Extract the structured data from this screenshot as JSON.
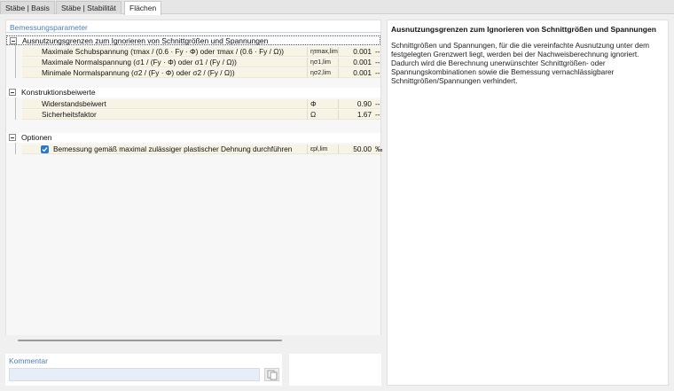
{
  "tabs": [
    {
      "label": "Stäbe | Basis"
    },
    {
      "label": "Stäbe | Stabilität"
    },
    {
      "label": "Flächen"
    }
  ],
  "params_panel": {
    "title": "Bemessungsparameter",
    "groups": [
      {
        "label": "Ausnutzungsgrenzen zum Ignorieren von Schnittgrößen und Spannungen",
        "rows": [
          {
            "label": "Maximale Schubspannung (τmax / (0.6 · Fy · Φ) oder τmax / (0.6 · Fy / Ω))",
            "symbol": "ητmax,lim",
            "value": "0.001",
            "unit": "--"
          },
          {
            "label": "Maximale Normalspannung (σ1 / (Fy · Φ) oder σ1 / (Fy / Ω))",
            "symbol": "ησ1,lim",
            "value": "0.001",
            "unit": "--"
          },
          {
            "label": "Minimale Normalspannung (σ2 / (Fy · Φ) oder σ2 / (Fy / Ω))",
            "symbol": "ησ2,lim",
            "value": "0.001",
            "unit": "--"
          }
        ]
      },
      {
        "label": "Konstruktionsbeiwerte",
        "rows": [
          {
            "label": "Widerstandsbeiwert",
            "symbol": "Φ",
            "value": "0.90",
            "unit": "--"
          },
          {
            "label": "Sicherheitsfaktor",
            "symbol": "Ω",
            "value": "1.67",
            "unit": "--"
          }
        ]
      },
      {
        "label": "Optionen",
        "rows": [
          {
            "label": "Bemessung gemäß maximal zulässiger plastischer Dehnung durchführen",
            "symbol": "εpl,lim",
            "value": "50.00",
            "unit": "‰",
            "checked": true
          }
        ]
      }
    ]
  },
  "comment": {
    "label": "Kommentar",
    "value": ""
  },
  "info": {
    "title": "Ausnutzungsgrenzen zum Ignorieren von Schnittgrößen und Spannungen",
    "text": "Schnittgrößen und Spannungen, für die die vereinfachte Ausnutzung unter dem festgelegten Grenzwert liegt, werden bei der Nachweisberechnung ignoriert. Dadurch wird die Berechnung unerwünschter Schnittgrößen- oder Spannungskombinationen sowie die Bemessung vernachlässigbarer Schnittgrößen/Spannungen verhindert."
  },
  "colors": {
    "accent": "#4a7fb5",
    "checkbox": "#2b79c9",
    "row_bg": "#f7f4e6"
  }
}
